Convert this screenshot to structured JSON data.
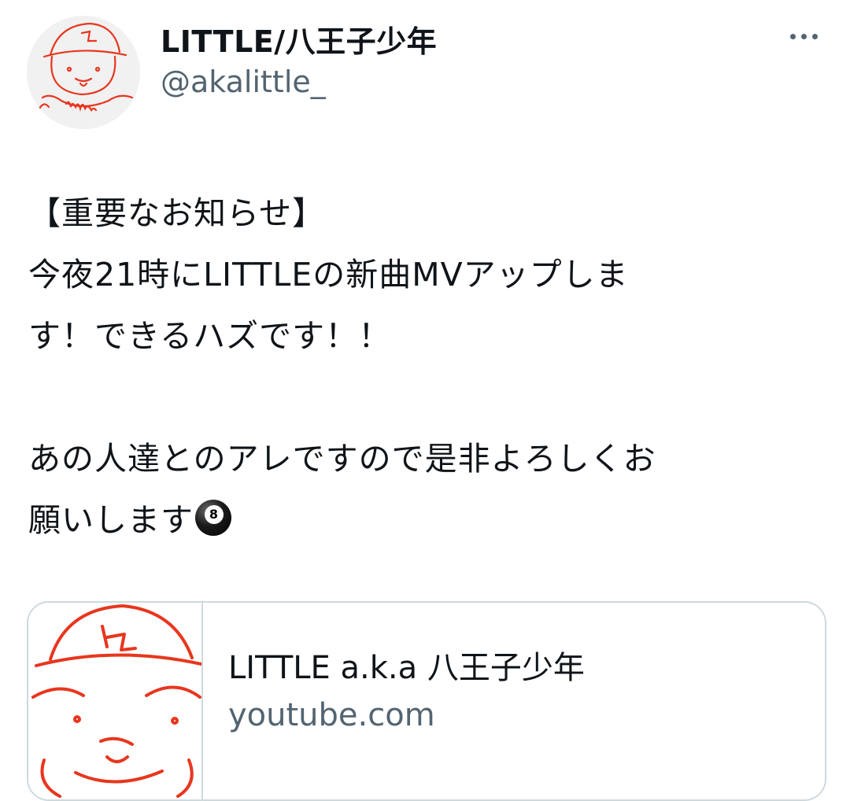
{
  "author": {
    "display_name": "LITTLE/八王子少年",
    "handle": "@akalittle_"
  },
  "tweet": {
    "lines": [
      "【重要なお知らせ】",
      "今夜21時にLITTLEの新曲MVアップしま",
      "す！できるハズです！！",
      "",
      "あの人達とのアレですので是非よろしくお",
      "願いします"
    ],
    "emoji": "pool-8-ball-icon",
    "emoji_label": "8"
  },
  "link_card": {
    "title": "LITTLE a.k.a 八王子少年",
    "domain": "youtube.com"
  },
  "colors": {
    "text": "#0f1419",
    "secondary": "#536471",
    "border": "#cfd9de",
    "sketch_red": "#e8361e"
  },
  "icons": {
    "more": "more-horizontal-icon",
    "avatar": "avatar-sketch-drawing"
  }
}
